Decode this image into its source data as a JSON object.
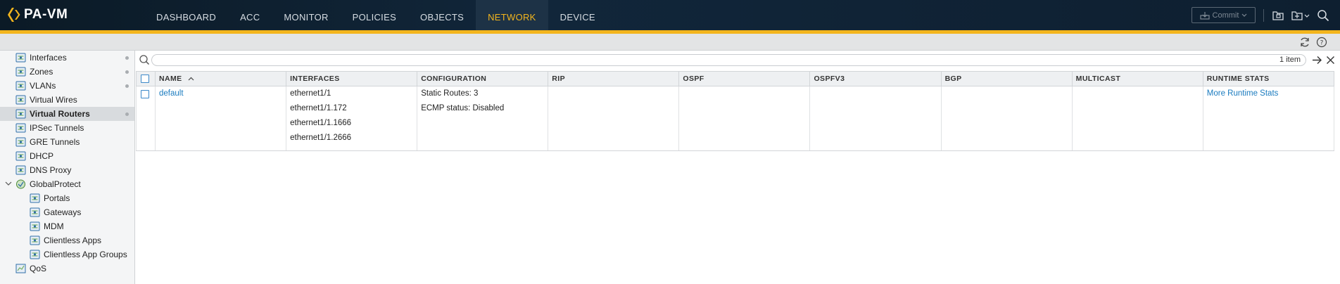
{
  "app": {
    "logo_text": "PA-VM",
    "brand_color": "#f3b51d"
  },
  "nav": {
    "tabs": [
      {
        "label": "DASHBOARD",
        "active": false
      },
      {
        "label": "ACC",
        "active": false
      },
      {
        "label": "MONITOR",
        "active": false
      },
      {
        "label": "POLICIES",
        "active": false
      },
      {
        "label": "OBJECTS",
        "active": false
      },
      {
        "label": "NETWORK",
        "active": true
      },
      {
        "label": "DEVICE",
        "active": false
      }
    ]
  },
  "toolbar": {
    "commit_label": "Commit",
    "icons": [
      "commit-lock-icon",
      "config-lock-icon",
      "folder-icon",
      "search-icon"
    ]
  },
  "subtoolbar": {
    "icons": [
      "refresh-icon",
      "help-icon"
    ]
  },
  "sidebar": {
    "items": [
      {
        "label": "Interfaces",
        "icon": "interfaces-icon",
        "dot": true
      },
      {
        "label": "Zones",
        "icon": "zones-icon",
        "dot": true
      },
      {
        "label": "VLANs",
        "icon": "vlans-icon",
        "dot": true
      },
      {
        "label": "Virtual Wires",
        "icon": "virtual-wires-icon",
        "dot": false
      },
      {
        "label": "Virtual Routers",
        "icon": "virtual-routers-icon",
        "dot": true,
        "selected": true
      },
      {
        "label": "IPSec Tunnels",
        "icon": "ipsec-tunnels-icon",
        "dot": false
      },
      {
        "label": "GRE Tunnels",
        "icon": "gre-tunnels-icon",
        "dot": false
      },
      {
        "label": "DHCP",
        "icon": "dhcp-icon",
        "dot": false
      },
      {
        "label": "DNS Proxy",
        "icon": "dns-proxy-icon",
        "dot": false
      },
      {
        "label": "GlobalProtect",
        "icon": "globalprotect-icon",
        "dot": false,
        "expanded": true
      },
      {
        "label": "Portals",
        "icon": "portals-icon",
        "dot": false,
        "child": true
      },
      {
        "label": "Gateways",
        "icon": "gateways-icon",
        "dot": false,
        "child": true
      },
      {
        "label": "MDM",
        "icon": "mdm-icon",
        "dot": false,
        "child": true
      },
      {
        "label": "Clientless Apps",
        "icon": "clientless-apps-icon",
        "dot": false,
        "child": true
      },
      {
        "label": "Clientless App Groups",
        "icon": "clientless-app-groups-icon",
        "dot": false,
        "child": true
      },
      {
        "label": "QoS",
        "icon": "qos-icon",
        "dot": false
      }
    ]
  },
  "main": {
    "search": {
      "placeholder": "",
      "value": ""
    },
    "item_count": "1 item",
    "table": {
      "columns": [
        "NAME",
        "INTERFACES",
        "CONFIGURATION",
        "RIP",
        "OSPF",
        "OSPFV3",
        "BGP",
        "MULTICAST",
        "RUNTIME STATS"
      ],
      "rows": [
        {
          "name": "default",
          "interfaces": [
            "ethernet1/1",
            "ethernet1/1.172",
            "ethernet1/1.1666",
            "ethernet1/1.2666"
          ],
          "configuration": [
            "Static Routes: 3",
            "ECMP status: Disabled"
          ],
          "rip": "",
          "ospf": "",
          "ospfv3": "",
          "bgp": "",
          "multicast": "",
          "runtime_stats": "More Runtime Stats"
        }
      ]
    }
  }
}
